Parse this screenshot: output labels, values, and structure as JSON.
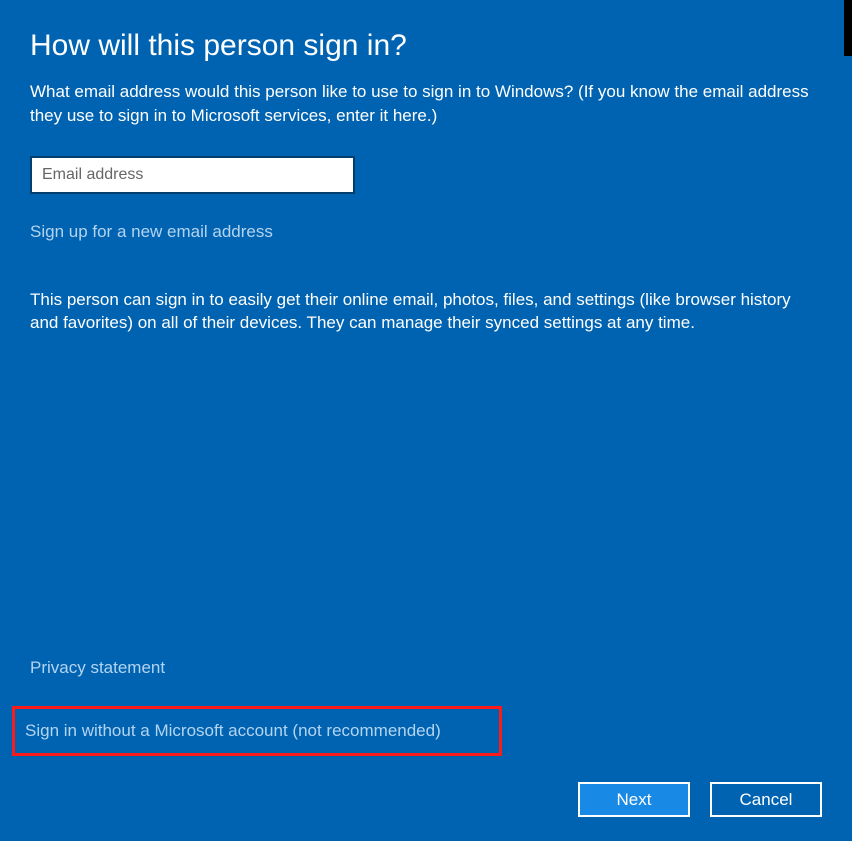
{
  "header": {
    "title": "How will this person sign in?",
    "description": "What email address would this person like to use to sign in to Windows? (If you know the email address they use to sign in to Microsoft services, enter it here.)"
  },
  "form": {
    "email_placeholder": "Email address",
    "email_value": "",
    "signup_link": "Sign up for a new email address"
  },
  "info": {
    "text": "This person can sign in to easily get their online email, photos, files, and settings (like browser history and favorites) on all of their devices. They can manage their synced settings at any time."
  },
  "links": {
    "privacy": "Privacy statement",
    "no_account": "Sign in without a Microsoft account (not recommended)"
  },
  "buttons": {
    "next": "Next",
    "cancel": "Cancel"
  }
}
